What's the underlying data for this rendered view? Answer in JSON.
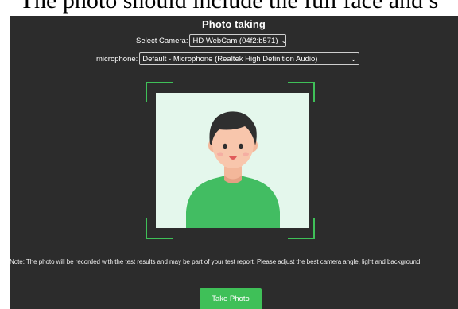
{
  "page_caption": "The photo should include the full face and s",
  "dialog": {
    "title": "Photo taking",
    "camera_label": "Select Camera:",
    "camera_value": "HD WebCam (04f2:b571)",
    "microphone_label": "microphone:",
    "microphone_value": "Default - Microphone (Realtek High Definition Audio)",
    "avatar_icon": "person-avatar-icon",
    "note": "Note: The photo will be recorded with the test results and may be part of your test report. Please adjust the best camera angle, light and background.",
    "take_photo_label": "Take Photo"
  },
  "colors": {
    "panel_bg": "#2c2c2c",
    "accent": "#3fc058",
    "preview_bg": "#e4f7ec"
  }
}
